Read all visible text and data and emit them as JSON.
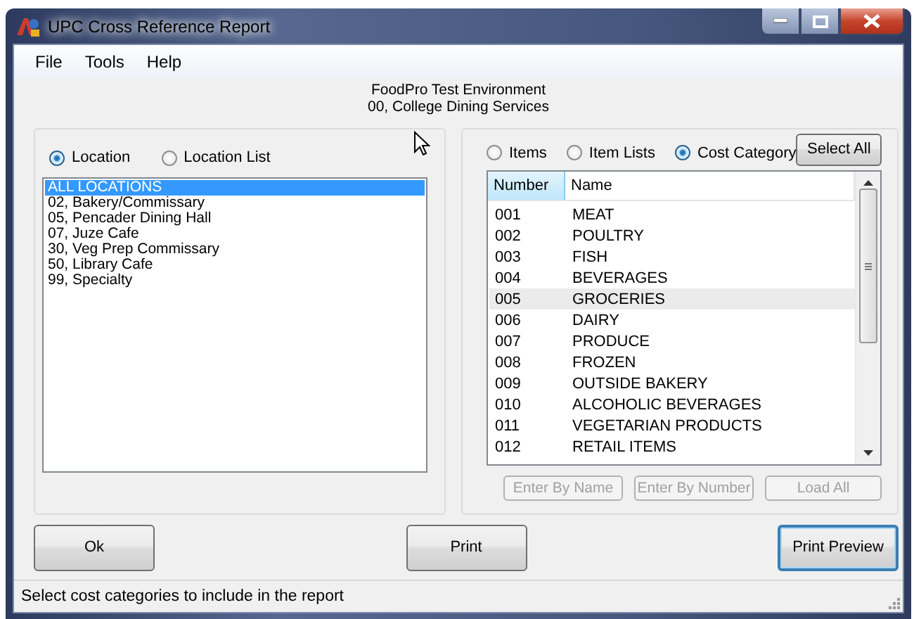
{
  "window": {
    "title": "UPC Cross Reference Report"
  },
  "menu": [
    {
      "label": "File"
    },
    {
      "label": "Tools"
    },
    {
      "label": "Help"
    }
  ],
  "header": {
    "environment": "FoodPro Test Environment",
    "unit": "00, College Dining Services"
  },
  "location_panel": {
    "modes": [
      {
        "label": "Location",
        "selected": true
      },
      {
        "label": "Location List",
        "selected": false
      }
    ],
    "items": [
      {
        "label": "ALL LOCATIONS",
        "selected": true
      },
      {
        "label": "02, Bakery/Commissary",
        "selected": false
      },
      {
        "label": "05, Pencader Dining Hall",
        "selected": false
      },
      {
        "label": "07, Juze Cafe",
        "selected": false
      },
      {
        "label": "30, Veg Prep Commissary",
        "selected": false
      },
      {
        "label": "50, Library Cafe",
        "selected": false
      },
      {
        "label": "99, Specialty",
        "selected": false
      }
    ]
  },
  "category_panel": {
    "modes": [
      {
        "label": "Items",
        "selected": false
      },
      {
        "label": "Item Lists",
        "selected": false
      },
      {
        "label": "Cost Category",
        "selected": true
      }
    ],
    "select_all": "Select All",
    "columns": [
      {
        "label": "Number",
        "hovered": true
      },
      {
        "label": "Name",
        "hovered": false
      }
    ],
    "rows": [
      {
        "number": "001",
        "name": "MEAT",
        "selected": false
      },
      {
        "number": "002",
        "name": "POULTRY",
        "selected": false
      },
      {
        "number": "003",
        "name": "FISH",
        "selected": false
      },
      {
        "number": "004",
        "name": "BEVERAGES",
        "selected": false
      },
      {
        "number": "005",
        "name": "GROCERIES",
        "selected": true
      },
      {
        "number": "006",
        "name": "DAIRY",
        "selected": false
      },
      {
        "number": "007",
        "name": "PRODUCE",
        "selected": false
      },
      {
        "number": "008",
        "name": "FROZEN",
        "selected": false
      },
      {
        "number": "009",
        "name": "OUTSIDE BAKERY",
        "selected": false
      },
      {
        "number": "010",
        "name": "ALCOHOLIC BEVERAGES",
        "selected": false
      },
      {
        "number": "011",
        "name": "VEGETARIAN PRODUCTS",
        "selected": false
      },
      {
        "number": "012",
        "name": "RETAIL ITEMS",
        "selected": false
      }
    ],
    "entry_buttons": [
      {
        "label": "Enter By Name",
        "disabled": true
      },
      {
        "label": "Enter By Number",
        "disabled": true
      },
      {
        "label": "Load All",
        "disabled": true
      }
    ]
  },
  "buttons": [
    {
      "label": "Ok",
      "focused": false
    },
    {
      "label": "Print",
      "focused": false
    },
    {
      "label": "Print Preview",
      "focused": true
    }
  ],
  "status_bar": "Select cost categories to include in the report"
}
